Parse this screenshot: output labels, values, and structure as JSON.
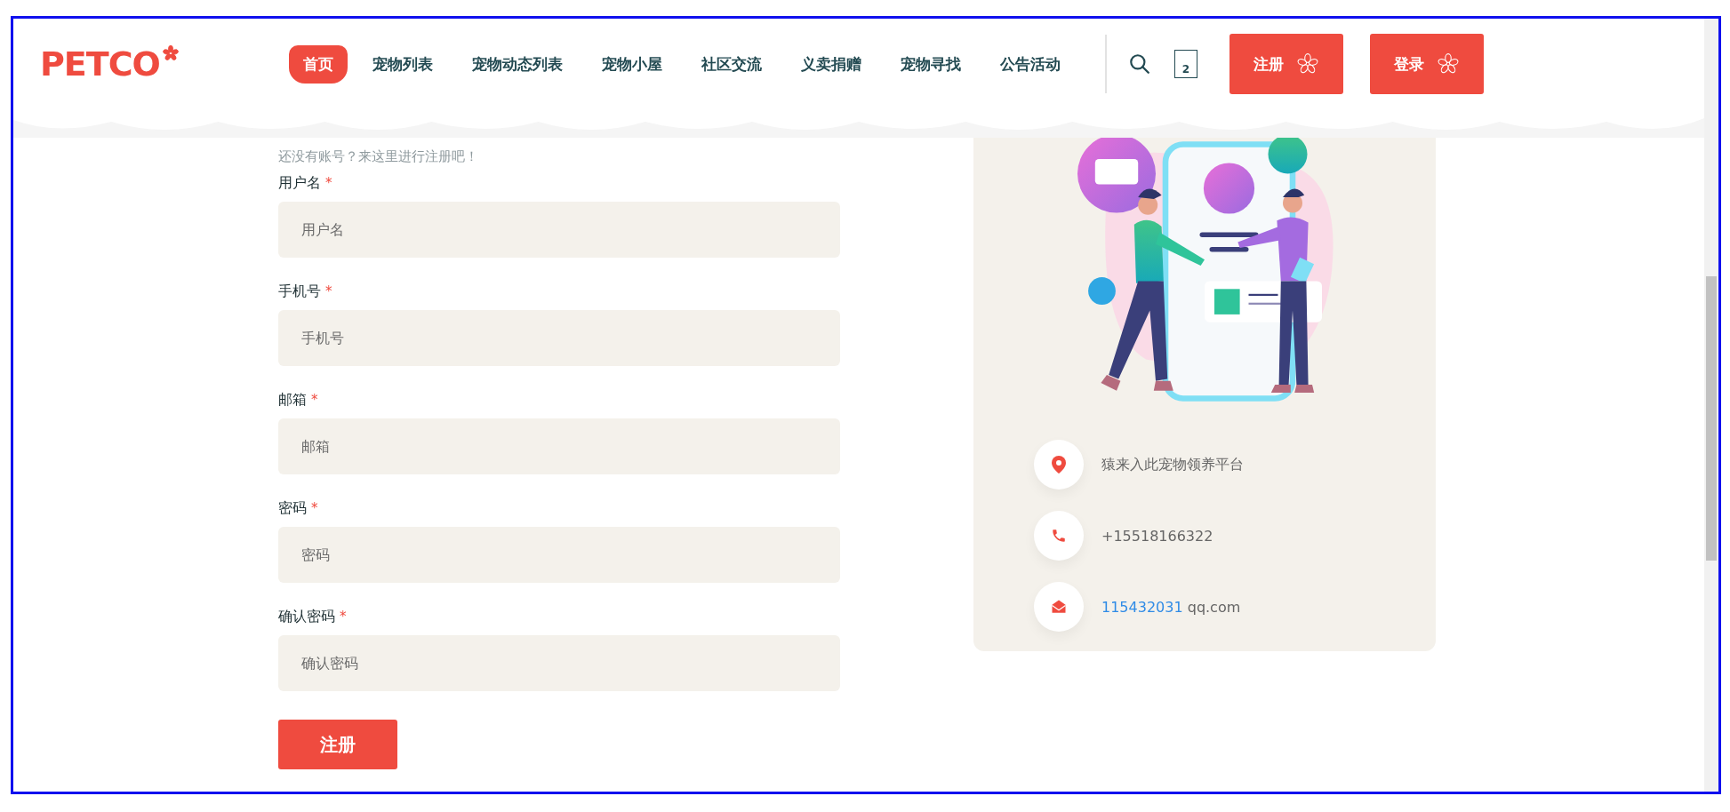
{
  "logo": {
    "text": "PETCO"
  },
  "nav": [
    {
      "label": "首页",
      "selected": true
    },
    {
      "label": "宠物列表",
      "selected": false
    },
    {
      "label": "宠物动态列表",
      "selected": false
    },
    {
      "label": "宠物小屋",
      "selected": false
    },
    {
      "label": "社区交流",
      "selected": false
    },
    {
      "label": "义卖捐赠",
      "selected": false
    },
    {
      "label": "宠物寻找",
      "selected": false
    },
    {
      "label": "公告活动",
      "selected": false
    }
  ],
  "header_actions": {
    "cart_count": "2",
    "buttons": [
      {
        "label": "注册"
      },
      {
        "label": "登录"
      }
    ]
  },
  "form": {
    "intro": "还没有账号？来这里进行注册吧！",
    "fields": [
      {
        "label": "用户名",
        "mark": "*",
        "placeholder": "用户名"
      },
      {
        "label": "手机号",
        "mark": "*",
        "placeholder": "手机号"
      },
      {
        "label": "邮箱",
        "mark": "*",
        "placeholder": "邮箱"
      },
      {
        "label": "密码",
        "mark": "*",
        "placeholder": "密码"
      },
      {
        "label": "确认密码",
        "mark": "*",
        "placeholder": "确认密码"
      }
    ],
    "submit": "注册"
  },
  "contact": [
    {
      "kind": "address",
      "text": "猿来入此宠物领养平台"
    },
    {
      "kind": "phone",
      "text": "+15518166322"
    },
    {
      "kind": "email",
      "link": "115432031",
      "text": "qq.com"
    }
  ]
}
